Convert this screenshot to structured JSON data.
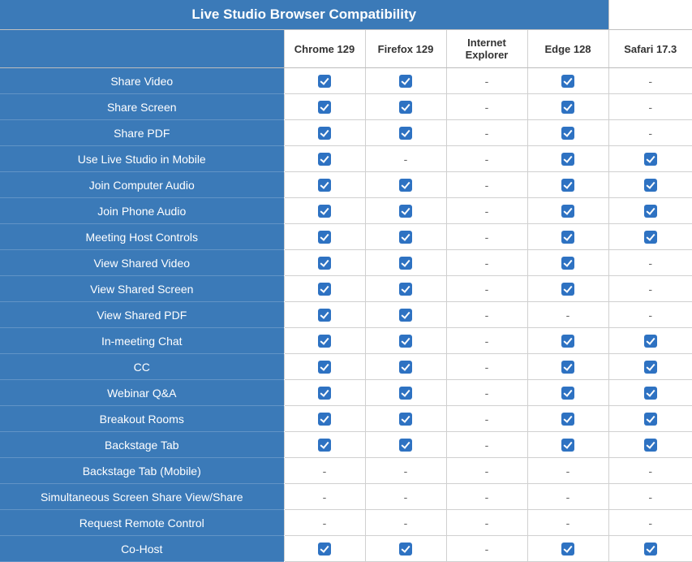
{
  "chart_data": {
    "type": "table",
    "title": "Live Studio Browser Compatibility",
    "columns": [
      "Chrome 129",
      "Firefox 129",
      "Internet Explorer",
      "Edge 128",
      "Safari 17.3"
    ],
    "rows": [
      {
        "feature": "Share Video",
        "values": [
          "✓",
          "✓",
          "-",
          "✓",
          "-"
        ]
      },
      {
        "feature": "Share Screen",
        "values": [
          "✓",
          "✓",
          "-",
          "✓",
          "-"
        ]
      },
      {
        "feature": "Share PDF",
        "values": [
          "✓",
          "✓",
          "-",
          "✓",
          "-"
        ]
      },
      {
        "feature": "Use Live Studio in Mobile",
        "values": [
          "✓",
          "-",
          "-",
          "✓",
          "✓"
        ]
      },
      {
        "feature": "Join Computer Audio",
        "values": [
          "✓",
          "✓",
          "-",
          "✓",
          "✓"
        ]
      },
      {
        "feature": "Join Phone Audio",
        "values": [
          "✓",
          "✓",
          "-",
          "✓",
          "✓"
        ]
      },
      {
        "feature": "Meeting Host Controls",
        "values": [
          "✓",
          "✓",
          "-",
          "✓",
          "✓"
        ]
      },
      {
        "feature": "View Shared Video",
        "values": [
          "✓",
          "✓",
          "-",
          "✓",
          "-"
        ]
      },
      {
        "feature": "View Shared Screen",
        "values": [
          "✓",
          "✓",
          "-",
          "✓",
          "-"
        ]
      },
      {
        "feature": "View Shared PDF",
        "values": [
          "✓",
          "✓",
          "-",
          "-",
          "-"
        ]
      },
      {
        "feature": "In-meeting Chat",
        "values": [
          "✓",
          "✓",
          "-",
          "✓",
          "✓"
        ]
      },
      {
        "feature": "CC",
        "values": [
          "✓",
          "✓",
          "-",
          "✓",
          "✓"
        ]
      },
      {
        "feature": "Webinar Q&A",
        "values": [
          "✓",
          "✓",
          "-",
          "✓",
          "✓"
        ]
      },
      {
        "feature": "Breakout Rooms",
        "values": [
          "✓",
          "✓",
          "-",
          "✓",
          "✓"
        ]
      },
      {
        "feature": "Backstage Tab",
        "values": [
          "✓",
          "✓",
          "-",
          "✓",
          "✓"
        ]
      },
      {
        "feature": "Backstage Tab (Mobile)",
        "values": [
          "-",
          "-",
          "-",
          "-",
          "-"
        ]
      },
      {
        "feature": "Simultaneous Screen Share View/Share",
        "values": [
          "-",
          "-",
          "-",
          "-",
          "-"
        ]
      },
      {
        "feature": "Request Remote Control",
        "values": [
          "-",
          "-",
          "-",
          "-",
          "-"
        ]
      },
      {
        "feature": "Co-Host",
        "values": [
          "✓",
          "✓",
          "-",
          "✓",
          "✓"
        ]
      }
    ]
  }
}
